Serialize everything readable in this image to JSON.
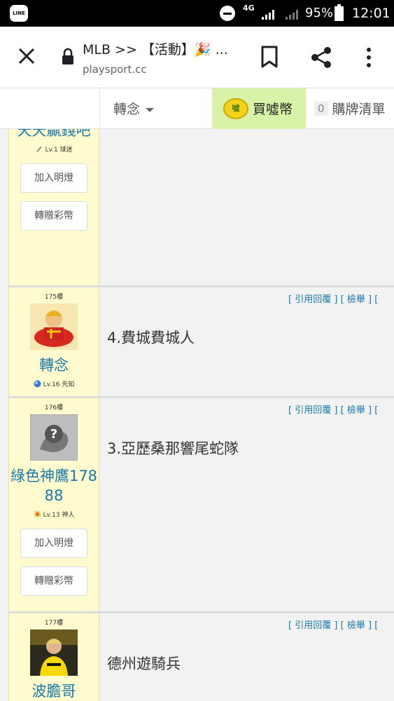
{
  "status_bar": {
    "app_icon": "LINE",
    "network": "4G",
    "battery": "95%",
    "time": "12:01"
  },
  "browser": {
    "title": "MLB >> 【活動】🎉 ...",
    "url": "playsport.cc",
    "icons": [
      "close-icon",
      "lock-icon",
      "bookmark-icon",
      "share-icon",
      "more-vertical-icon"
    ]
  },
  "tabs": {
    "user": "轉念",
    "coins": "買噓幣",
    "coin_badge": "噓",
    "cart_count": "0",
    "cart": "購牌清單"
  },
  "posts": [
    {
      "username": "天天贏錢吧",
      "level": "Lv.1 球迷",
      "buttons": [
        "加入明燈",
        "轉贈彩幣"
      ]
    },
    {
      "floor": "175樓",
      "username": "轉念",
      "level": "Lv.16 先知",
      "quote": "引用回覆",
      "report": "檢舉",
      "text": "4.費城費城人"
    },
    {
      "floor": "176樓",
      "username": "綠色神鷹17888",
      "level": "Lv.13 神人",
      "quote": "引用回覆",
      "report": "檢舉",
      "text": "3.亞歷桑那響尾蛇隊",
      "buttons": [
        "加入明燈",
        "轉贈彩幣"
      ]
    },
    {
      "floor": "177樓",
      "username": "波膽哥",
      "quote": "引用回覆",
      "report": "檢舉",
      "text": "德州遊騎兵"
    }
  ]
}
